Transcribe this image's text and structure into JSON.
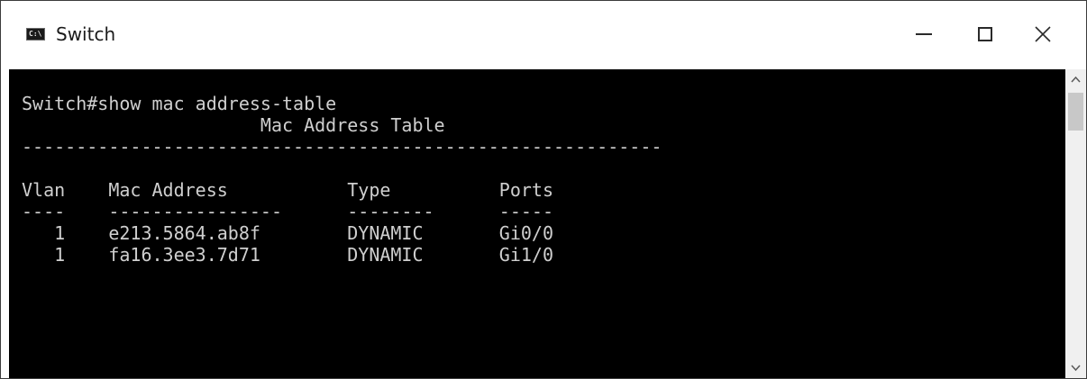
{
  "window": {
    "title": "Switch",
    "icon": "console-icon"
  },
  "controls": {
    "minimize_icon": "minimize-icon",
    "maximize_icon": "maximize-icon",
    "close_icon": "close-icon"
  },
  "console": {
    "background": "#000000",
    "foreground": "#cfcfcf",
    "lines": [
      "Switch#show mac address-table",
      "                      Mac Address Table",
      "-----------------------------------------------------------",
      "",
      "Vlan    Mac Address           Type          Ports",
      "----    ----------------      --------      -----",
      "   1    e213.5864.ab8f        DYNAMIC       Gi0/0",
      "   1    fa16.3ee3.7d71        DYNAMIC       Gi1/0"
    ]
  },
  "scrollbar": {
    "up_icon": "chevron-up-icon",
    "down_icon": "chevron-down-icon"
  }
}
